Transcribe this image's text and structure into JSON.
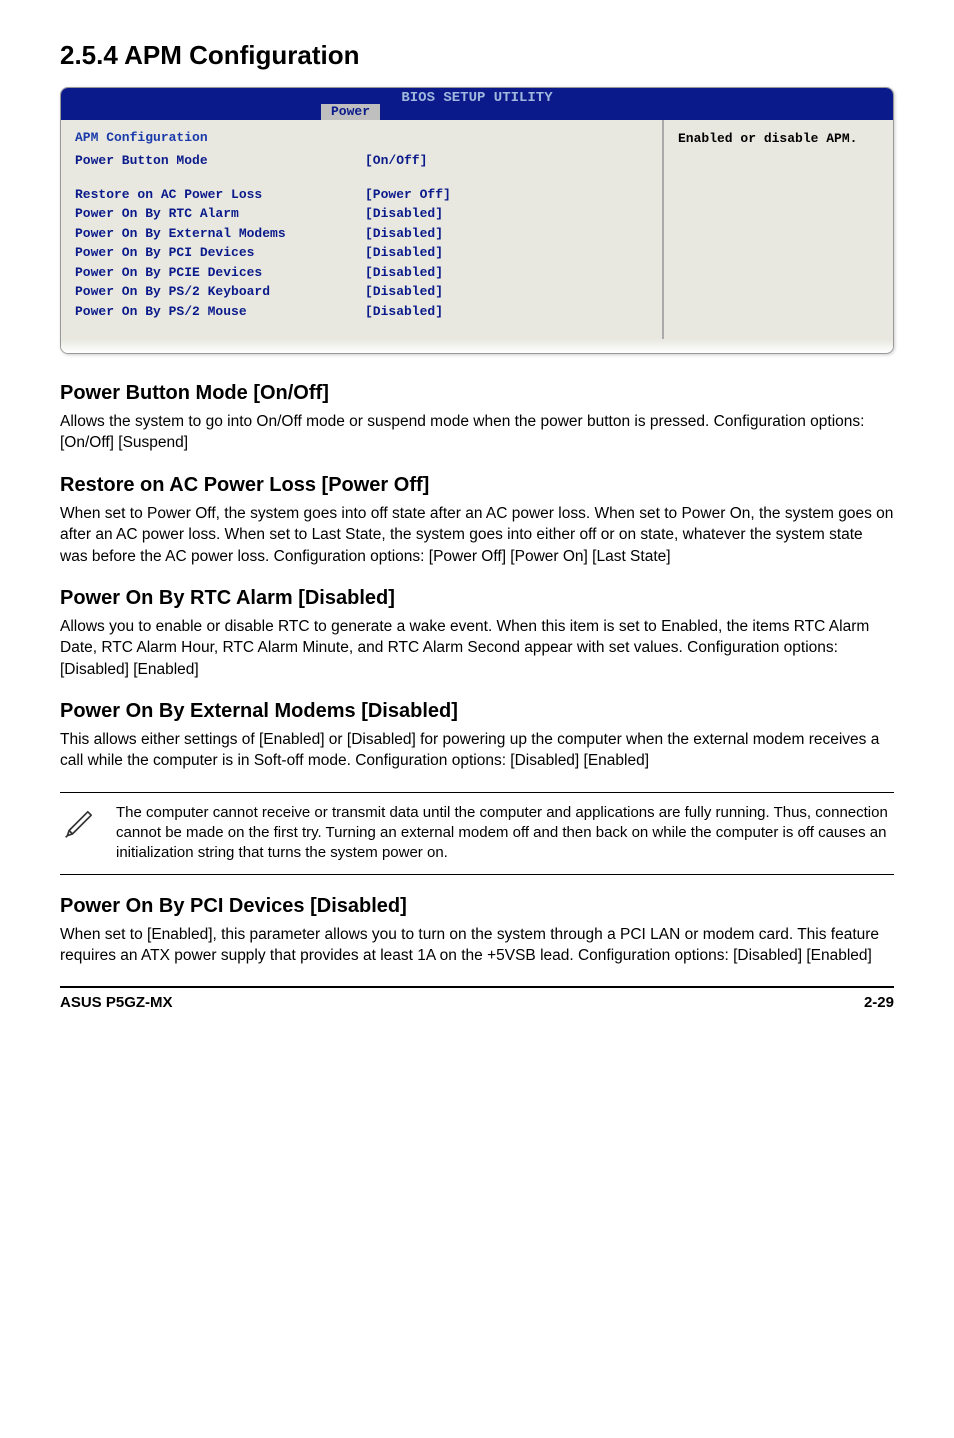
{
  "heading": "2.5.4   APM Configuration",
  "bios": {
    "header_title": "BIOS SETUP UTILITY",
    "tab_label": "Power",
    "section_title": "APM Configuration",
    "help_text": "Enabled or disable APM.",
    "rows": [
      {
        "label": "Power Button Mode",
        "value": "[On/Off]"
      },
      {
        "label": "",
        "value": ""
      },
      {
        "label": "Restore on AC Power Loss",
        "value": "[Power Off]"
      },
      {
        "label": "Power On By RTC Alarm",
        "value": "[Disabled]"
      },
      {
        "label": "Power On By External Modems",
        "value": "[Disabled]"
      },
      {
        "label": "Power On By PCI Devices",
        "value": "[Disabled]"
      },
      {
        "label": "Power On By PCIE Devices",
        "value": "[Disabled]"
      },
      {
        "label": "Power On By PS/2 Keyboard",
        "value": "[Disabled]"
      },
      {
        "label": "Power On By PS/2 Mouse",
        "value": "[Disabled]"
      }
    ]
  },
  "sections": [
    {
      "title": "Power Button Mode [On/Off]",
      "body": "Allows the system to go into On/Off mode or suspend mode when the power button is pressed. Configuration options: [On/Off] [Suspend]"
    },
    {
      "title": "Restore on AC Power Loss [Power Off]",
      "body": "When set to Power Off, the system goes into off state after an AC power loss. When set to Power On, the system goes on after an AC power loss. When set to Last State, the system goes into either off or on state, whatever the system state was before the AC power loss. Configuration options: [Power Off] [Power On] [Last State]"
    },
    {
      "title": "Power On By RTC Alarm [Disabled]",
      "body": "Allows you to enable or disable RTC to generate a wake event. When this item is set to Enabled, the items RTC Alarm Date, RTC Alarm Hour, RTC Alarm Minute, and RTC Alarm Second appear with set values. Configuration options: [Disabled] [Enabled]"
    },
    {
      "title": "Power On By External Modems [Disabled]",
      "body": "This allows either settings of [Enabled] or [Disabled] for powering up the computer when the external modem receives a call while the computer is in Soft-off mode. Configuration options: [Disabled] [Enabled]"
    }
  ],
  "note": {
    "icon_name": "pencil-note-icon",
    "text": "The computer cannot receive or transmit data until the computer and applications are fully running. Thus, connection cannot be made on the first try. Turning an external modem off and then back on while the computer is off causes an initialization string that turns the system power on."
  },
  "last_section": {
    "title": "Power On By PCI Devices [Disabled]",
    "body": "When set to [Enabled], this parameter allows you to turn on the system through a PCI LAN or modem card. This feature requires an ATX power supply that provides at least 1A on the +5VSB lead. Configuration options: [Disabled] [Enabled]"
  },
  "footer": {
    "left": "ASUS P5GZ-MX",
    "right": "2-29"
  }
}
